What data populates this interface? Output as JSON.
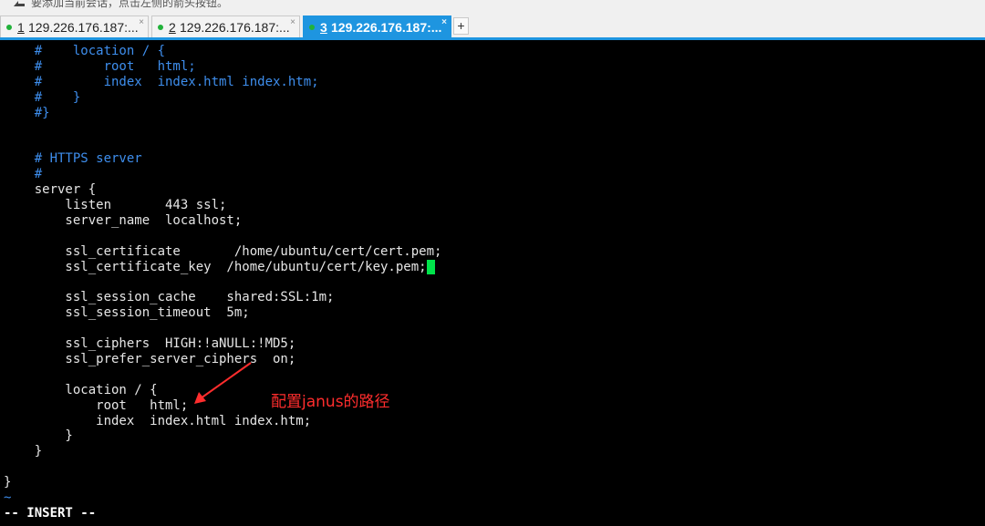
{
  "topbar": {
    "hint": "要添加当前会话，点击左侧的箭头按钮。",
    "hint_icon": "arrow-icon"
  },
  "tabs": [
    {
      "index": "1",
      "title": "129.226.176.187:...",
      "active": false,
      "status_color": "#21b23a"
    },
    {
      "index": "2",
      "title": "129.226.176.187:...",
      "active": false,
      "status_color": "#21b23a"
    },
    {
      "index": "3",
      "title": "129.226.176.187:...",
      "active": true,
      "status_color": "#21b23a"
    }
  ],
  "tab_add_label": "+",
  "tab_close_label": "×",
  "colors": {
    "accent": "#1e95e0",
    "comment": "#3e8eed",
    "text": "#e6e6e6",
    "cursor": "#00e34a",
    "annotation": "#ff2d2d"
  },
  "terminal": {
    "lines": [
      {
        "text": "    #    location / {",
        "style": "comment"
      },
      {
        "text": "    #        root   html;",
        "style": "comment"
      },
      {
        "text": "    #        index  index.html index.htm;",
        "style": "comment"
      },
      {
        "text": "    #    }",
        "style": "comment"
      },
      {
        "text": "    #}",
        "style": "comment"
      },
      {
        "text": "",
        "style": "normal"
      },
      {
        "text": "",
        "style": "normal"
      },
      {
        "text": "    # HTTPS server",
        "style": "comment"
      },
      {
        "text": "    #",
        "style": "comment"
      },
      {
        "text": "    server {",
        "style": "normal"
      },
      {
        "text": "        listen       443 ssl;",
        "style": "normal"
      },
      {
        "text": "        server_name  localhost;",
        "style": "normal"
      },
      {
        "text": "",
        "style": "normal"
      },
      {
        "text": "        ssl_certificate       /home/ubuntu/cert/cert.pem;",
        "style": "normal"
      },
      {
        "text": "        ssl_certificate_key  /home/ubuntu/cert/key.pem;",
        "style": "normal"
      },
      {
        "text": "",
        "style": "normal"
      },
      {
        "text": "        ssl_session_cache    shared:SSL:1m;",
        "style": "normal"
      },
      {
        "text": "        ssl_session_timeout  5m;",
        "style": "normal"
      },
      {
        "text": "",
        "style": "normal"
      },
      {
        "text": "        ssl_ciphers  HIGH:!aNULL:!MD5;",
        "style": "normal"
      },
      {
        "text": "        ssl_prefer_server_ciphers  on;",
        "style": "normal"
      },
      {
        "text": "",
        "style": "normal"
      },
      {
        "text": "        location / {",
        "style": "normal"
      },
      {
        "text": "            root   html;",
        "style": "normal"
      },
      {
        "text": "            index  index.html index.htm;",
        "style": "normal"
      },
      {
        "text": "        }",
        "style": "normal"
      },
      {
        "text": "    }",
        "style": "normal"
      },
      {
        "text": "",
        "style": "normal"
      },
      {
        "text": "}",
        "style": "normal"
      },
      {
        "text": "~",
        "style": "tilde"
      }
    ],
    "mode_line": "-- INSERT --"
  },
  "annotation": {
    "text": "配置janus的路径",
    "icon": "red-arrow-icon"
  }
}
